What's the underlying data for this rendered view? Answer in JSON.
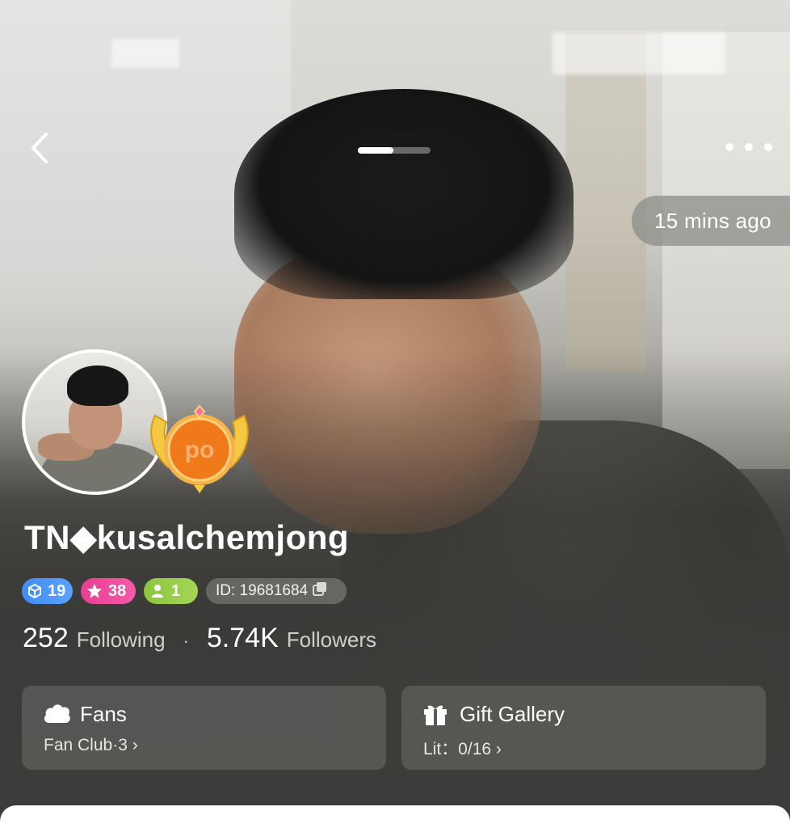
{
  "header": {
    "back_icon": "chevron-left-icon",
    "more_icon": "more-horizontal-icon",
    "photo_pager": {
      "count": 2,
      "active_index": 0
    }
  },
  "hero": {
    "time_ago": "15 mins ago"
  },
  "profile": {
    "username": "TN◆kusalchemjong",
    "level_badges": [
      {
        "icon": "cube-icon",
        "value": "19",
        "color": "#3f8df7"
      },
      {
        "icon": "star-icon",
        "value": "38",
        "color": "#ea3e93"
      },
      {
        "icon": "person-icon",
        "value": "1",
        "color": "#8dc63f"
      }
    ],
    "id_label": "ID: 19681684",
    "copy_icon": "copy-icon",
    "following_count": "252",
    "following_label": "Following",
    "separator": "·",
    "followers_count": "5.74K",
    "followers_label": "Followers"
  },
  "cards": {
    "fans": {
      "icon": "fans-cloud-icon",
      "title": "Fans",
      "subtitle": "Fan Club·3 ›"
    },
    "gifts": {
      "icon": "gift-icon",
      "title": "Gift Gallery",
      "subtitle": "Lit：0/16 ›"
    }
  },
  "colors": {
    "accent_orange": "#f07a1a",
    "gold": "#f2c94c"
  }
}
